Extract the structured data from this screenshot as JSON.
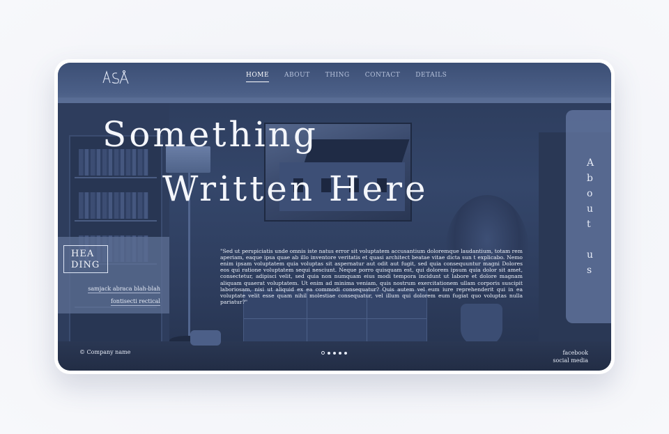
{
  "logo": {
    "text": "ASA",
    "icon": "compass-logo-icon"
  },
  "nav": {
    "items": [
      {
        "label": "HOME",
        "active": true
      },
      {
        "label": "ABOUT",
        "active": false
      },
      {
        "label": "THING",
        "active": false
      },
      {
        "label": "CONTACT",
        "active": false
      },
      {
        "label": "DETAILS",
        "active": false
      }
    ]
  },
  "hero": {
    "line1": "Something",
    "line2": "Written Here"
  },
  "heading_card": {
    "line1": "HEA",
    "line2": "DING",
    "link1": "samjack abraca blah-blah",
    "link2": "fontisecti rectical"
  },
  "quote": "\"Sed ut perspiciatis unde omnis iste natus error sit voluptatem accusantium doloremque laudantium, totam rem aperiam, eaque ipsa quae ab illo inventore veritatis et quasi architect beatae vitae dicta sun t explicabo. Nemo enim ipsam voluptatem quia voluptas sit aspernatur aut odit aut fugit, sed quia consequuntur magni Dolores eos qui ratione voluptatem sequi nesciunt. Neque porro quisquam est, qui dolorem ipsum quia dolor sit amet, consectetur, adipisci velit, sed quia non numquam eius modi tempora incidunt ut labore et dolore magnam aliquam quaerat voluptatem. Ut enim ad minima veniam, quis nostrum exercitationem ullam corporis suscipit laboriosam, nisi ut aliquid ex ea commodi consequatur? Quis autem vel eum iure reprehenderit qui in ea voluptate velit esse quam nihil molestiae consequatur, vel illum qui dolorem eum fugiat quo voluptas nulla pariatur?\"",
  "about_tab": {
    "letters": [
      "A",
      "b",
      "o",
      "u",
      "t",
      "",
      "u",
      "s"
    ]
  },
  "footer": {
    "copyright": "© Company name",
    "social_line1": "facebook",
    "social_line2": "social media",
    "pagination": {
      "total": 5,
      "current": 1
    }
  },
  "colors": {
    "overlay": "#2d3c5c",
    "accent_panel": "#6a7ea6",
    "text": "#f4f6fb"
  }
}
